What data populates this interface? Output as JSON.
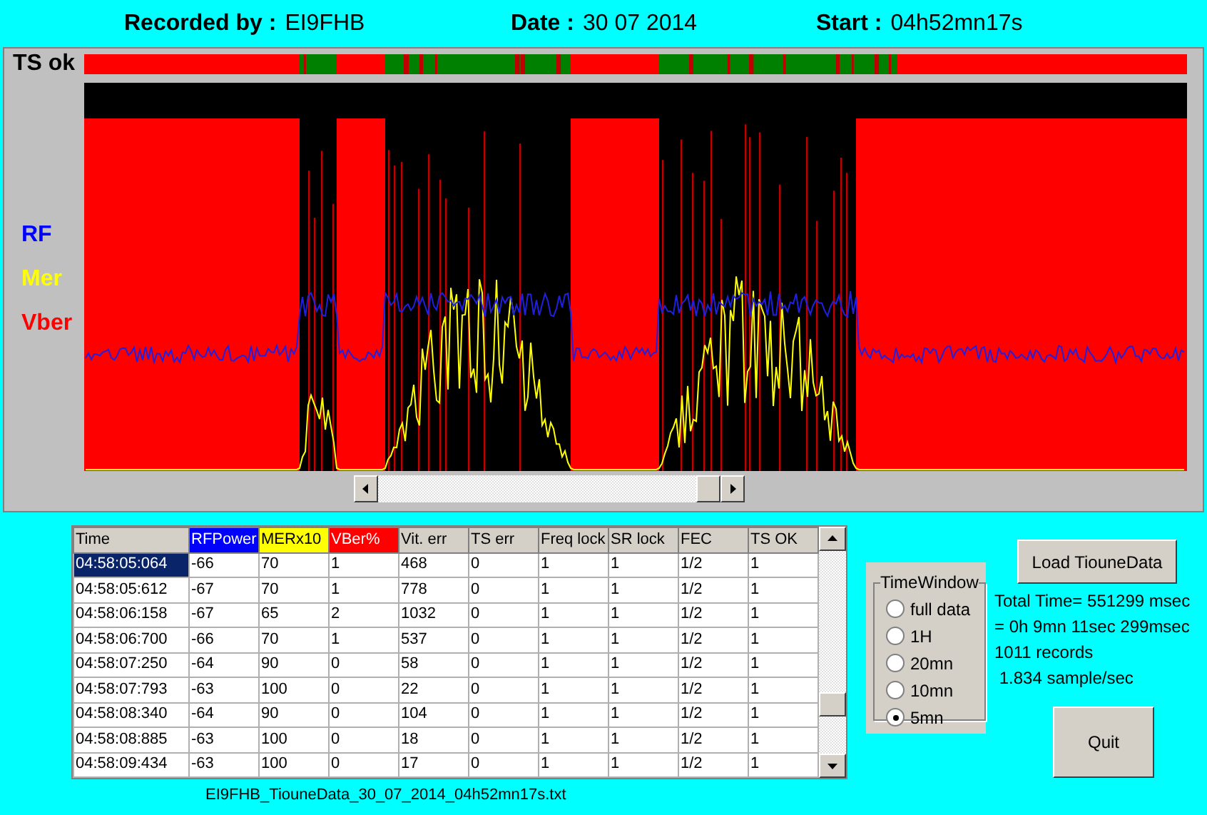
{
  "header": [
    {
      "label": "Recorded by :",
      "value": "EI9FHB"
    },
    {
      "label": "Date :",
      "value": "30 07 2014"
    },
    {
      "label": "Start :",
      "value": "04h52mn17s"
    }
  ],
  "status_strip": {
    "label": "TS ok"
  },
  "chart": {
    "legend": [
      {
        "label": "RF",
        "color": "#0000ff"
      },
      {
        "label": "Mer",
        "color": "#ffff00"
      },
      {
        "label": "Vber",
        "color": "#ff0000"
      }
    ]
  },
  "table": {
    "columns": [
      {
        "label": "Time"
      },
      {
        "label": "RFPower",
        "color": "#0000ff"
      },
      {
        "label": "MERx10",
        "color": "#ffff00"
      },
      {
        "label": "VBer%",
        "color": "#ff0000"
      },
      {
        "label": "Vit. err"
      },
      {
        "label": "TS err"
      },
      {
        "label": "Freq lock"
      },
      {
        "label": "SR lock"
      },
      {
        "label": "FEC"
      },
      {
        "label": "TS OK"
      }
    ],
    "rows": [
      {
        "selected": true,
        "cells": [
          "04:58:05:064",
          "-66",
          "70",
          "1",
          "468",
          "0",
          "1",
          "1",
          "1/2",
          "1"
        ]
      },
      {
        "selected": false,
        "cells": [
          "04:58:05:612",
          "-67",
          "70",
          "1",
          "778",
          "0",
          "1",
          "1",
          "1/2",
          "1"
        ]
      },
      {
        "selected": false,
        "cells": [
          "04:58:06:158",
          "-67",
          "65",
          "2",
          "1032",
          "0",
          "1",
          "1",
          "1/2",
          "1"
        ]
      },
      {
        "selected": false,
        "cells": [
          "04:58:06:700",
          "-66",
          "70",
          "1",
          "537",
          "0",
          "1",
          "1",
          "1/2",
          "1"
        ]
      },
      {
        "selected": false,
        "cells": [
          "04:58:07:250",
          "-64",
          "90",
          "0",
          "58",
          "0",
          "1",
          "1",
          "1/2",
          "1"
        ]
      },
      {
        "selected": false,
        "cells": [
          "04:58:07:793",
          "-63",
          "100",
          "0",
          "22",
          "0",
          "1",
          "1",
          "1/2",
          "1"
        ]
      },
      {
        "selected": false,
        "cells": [
          "04:58:08:340",
          "-64",
          "90",
          "0",
          "104",
          "0",
          "1",
          "1",
          "1/2",
          "1"
        ]
      },
      {
        "selected": false,
        "cells": [
          "04:58:08:885",
          "-63",
          "100",
          "0",
          "18",
          "0",
          "1",
          "1",
          "1/2",
          "1"
        ]
      },
      {
        "selected": false,
        "cells": [
          "04:58:09:434",
          "-63",
          "100",
          "0",
          "17",
          "0",
          "1",
          "1",
          "1/2",
          "1"
        ]
      }
    ]
  },
  "file_name": "EI9FHB_TiouneData_30_07_2014_04h52mn17s.txt",
  "time_window": {
    "title": "TimeWindow",
    "options": [
      {
        "label": "full data",
        "selected": false
      },
      {
        "label": "1H",
        "selected": false
      },
      {
        "label": "20mn",
        "selected": false
      },
      {
        "label": "10mn",
        "selected": false
      },
      {
        "label": "5mn",
        "selected": true
      }
    ]
  },
  "load_button": "Load TiouneData",
  "stats": [
    "Total Time= 551299 msec",
    "= 0h 9mn 11sec 299msec",
    "1011 records",
    " 1.834 sample/sec"
  ],
  "quit_button": "Quit"
}
